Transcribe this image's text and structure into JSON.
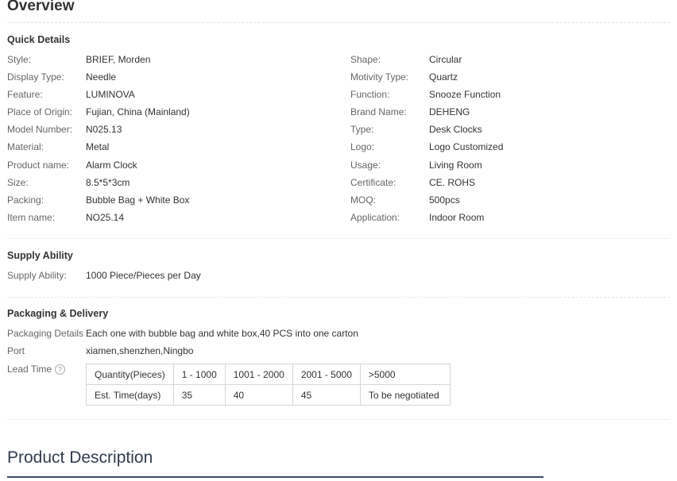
{
  "overview_title": "Overview",
  "quick_details": {
    "title": "Quick Details",
    "left": [
      {
        "label": "Style:",
        "value": "BRIEF, Morden"
      },
      {
        "label": "Display Type:",
        "value": "Needle"
      },
      {
        "label": "Feature:",
        "value": "LUMINOVA"
      },
      {
        "label": "Place of Origin:",
        "value": "Fujian, China (Mainland)"
      },
      {
        "label": "Model Number:",
        "value": "N025.13"
      },
      {
        "label": "Material:",
        "value": "Metal"
      },
      {
        "label": "Product name:",
        "value": "Alarm Clock"
      },
      {
        "label": "Size:",
        "value": "8.5*5*3cm"
      },
      {
        "label": "Packing:",
        "value": "Bubble Bag + White Box"
      },
      {
        "label": "Item name:",
        "value": "NO25.14"
      }
    ],
    "right": [
      {
        "label": "Shape:",
        "value": "Circular"
      },
      {
        "label": "Motivity Type:",
        "value": "Quartz"
      },
      {
        "label": "Function:",
        "value": "Snooze Function"
      },
      {
        "label": "Brand Name:",
        "value": "DEHENG"
      },
      {
        "label": "Type:",
        "value": "Desk Clocks"
      },
      {
        "label": "Logo:",
        "value": "Logo Customized"
      },
      {
        "label": "Usage:",
        "value": "Living Room"
      },
      {
        "label": "Certificate:",
        "value": "CE. ROHS"
      },
      {
        "label": "MOQ:",
        "value": "500pcs"
      },
      {
        "label": "Application:",
        "value": "Indoor Room"
      }
    ]
  },
  "supply_ability": {
    "title": "Supply Ability",
    "label": "Supply Ability:",
    "value": "1000 Piece/Pieces per Day"
  },
  "packaging_delivery": {
    "title": "Packaging & Delivery",
    "details_label": "Packaging Details",
    "details_value": "Each one with bubble bag and white box,40 PCS into one carton",
    "port_label": "Port",
    "port_value": "xiamen,shenzhen,Ningbo",
    "lead_time_label": "Lead Time",
    "help_icon": "?",
    "lead_table": {
      "header": [
        "Quantity(Pieces)",
        "1 - 1000",
        "1001 - 2000",
        "2001 - 5000",
        ">5000"
      ],
      "row": [
        "Est. Time(days)",
        "35",
        "40",
        "45",
        "To be negotiated"
      ]
    }
  },
  "product_description_title": "Product Description"
}
